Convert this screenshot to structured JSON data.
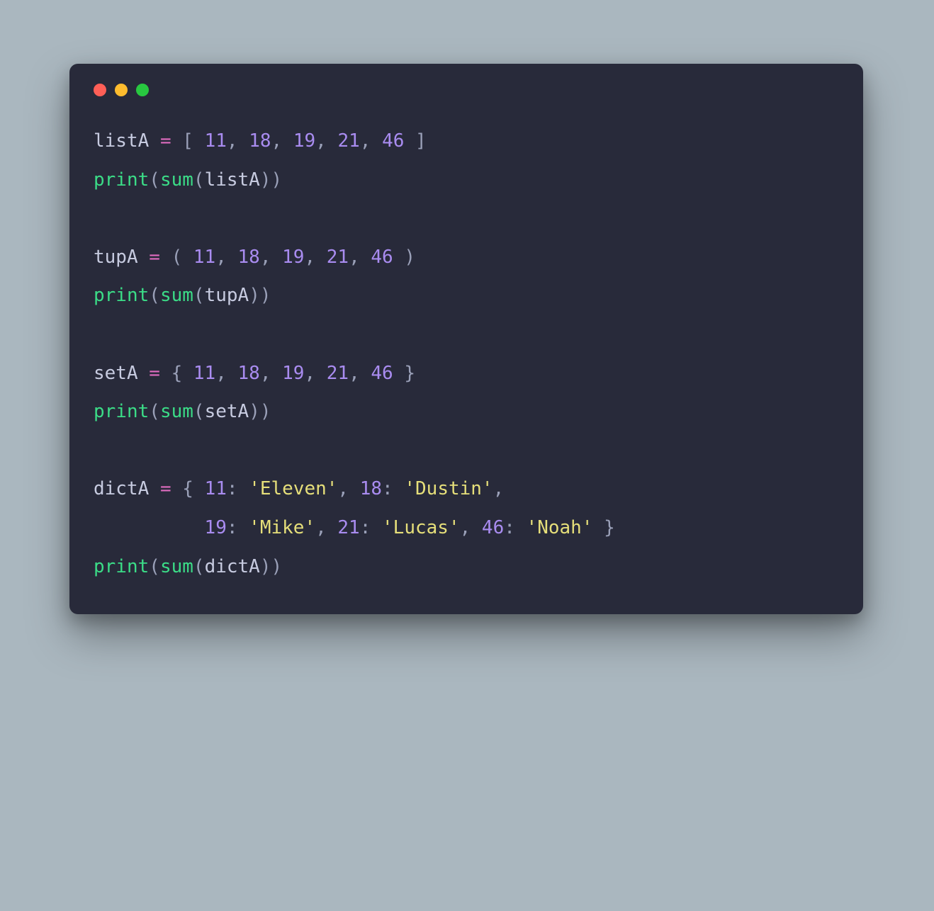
{
  "window": {
    "traffic": [
      "close",
      "minimize",
      "zoom"
    ]
  },
  "code": {
    "lines": [
      [
        {
          "t": "listA",
          "c": "ident"
        },
        {
          "t": " ",
          "c": "ident"
        },
        {
          "t": "=",
          "c": "op"
        },
        {
          "t": " [ ",
          "c": "punc"
        },
        {
          "t": "11",
          "c": "num"
        },
        {
          "t": ", ",
          "c": "punc"
        },
        {
          "t": "18",
          "c": "num"
        },
        {
          "t": ", ",
          "c": "punc"
        },
        {
          "t": "19",
          "c": "num"
        },
        {
          "t": ", ",
          "c": "punc"
        },
        {
          "t": "21",
          "c": "num"
        },
        {
          "t": ", ",
          "c": "punc"
        },
        {
          "t": "46",
          "c": "num"
        },
        {
          "t": " ]",
          "c": "punc"
        }
      ],
      [
        {
          "t": "print",
          "c": "func"
        },
        {
          "t": "(",
          "c": "punc"
        },
        {
          "t": "sum",
          "c": "builtin"
        },
        {
          "t": "(",
          "c": "punc"
        },
        {
          "t": "listA",
          "c": "ident"
        },
        {
          "t": "))",
          "c": "punc"
        }
      ],
      [],
      [
        {
          "t": "tupA",
          "c": "ident"
        },
        {
          "t": " ",
          "c": "ident"
        },
        {
          "t": "=",
          "c": "op"
        },
        {
          "t": " ( ",
          "c": "punc"
        },
        {
          "t": "11",
          "c": "num"
        },
        {
          "t": ", ",
          "c": "punc"
        },
        {
          "t": "18",
          "c": "num"
        },
        {
          "t": ", ",
          "c": "punc"
        },
        {
          "t": "19",
          "c": "num"
        },
        {
          "t": ", ",
          "c": "punc"
        },
        {
          "t": "21",
          "c": "num"
        },
        {
          "t": ", ",
          "c": "punc"
        },
        {
          "t": "46",
          "c": "num"
        },
        {
          "t": " )",
          "c": "punc"
        }
      ],
      [
        {
          "t": "print",
          "c": "func"
        },
        {
          "t": "(",
          "c": "punc"
        },
        {
          "t": "sum",
          "c": "builtin"
        },
        {
          "t": "(",
          "c": "punc"
        },
        {
          "t": "tupA",
          "c": "ident"
        },
        {
          "t": "))",
          "c": "punc"
        }
      ],
      [],
      [
        {
          "t": "setA",
          "c": "ident"
        },
        {
          "t": " ",
          "c": "ident"
        },
        {
          "t": "=",
          "c": "op"
        },
        {
          "t": " { ",
          "c": "punc"
        },
        {
          "t": "11",
          "c": "num"
        },
        {
          "t": ", ",
          "c": "punc"
        },
        {
          "t": "18",
          "c": "num"
        },
        {
          "t": ", ",
          "c": "punc"
        },
        {
          "t": "19",
          "c": "num"
        },
        {
          "t": ", ",
          "c": "punc"
        },
        {
          "t": "21",
          "c": "num"
        },
        {
          "t": ", ",
          "c": "punc"
        },
        {
          "t": "46",
          "c": "num"
        },
        {
          "t": " }",
          "c": "punc"
        }
      ],
      [
        {
          "t": "print",
          "c": "func"
        },
        {
          "t": "(",
          "c": "punc"
        },
        {
          "t": "sum",
          "c": "builtin"
        },
        {
          "t": "(",
          "c": "punc"
        },
        {
          "t": "setA",
          "c": "ident"
        },
        {
          "t": "))",
          "c": "punc"
        }
      ],
      [],
      [
        {
          "t": "dictA",
          "c": "ident"
        },
        {
          "t": " ",
          "c": "ident"
        },
        {
          "t": "=",
          "c": "op"
        },
        {
          "t": " { ",
          "c": "punc"
        },
        {
          "t": "11",
          "c": "num"
        },
        {
          "t": ": ",
          "c": "punc"
        },
        {
          "t": "'Eleven'",
          "c": "str"
        },
        {
          "t": ", ",
          "c": "punc"
        },
        {
          "t": "18",
          "c": "num"
        },
        {
          "t": ": ",
          "c": "punc"
        },
        {
          "t": "'Dustin'",
          "c": "str"
        },
        {
          "t": ",",
          "c": "punc"
        }
      ],
      [
        {
          "t": "          ",
          "c": "ident"
        },
        {
          "t": "19",
          "c": "num"
        },
        {
          "t": ": ",
          "c": "punc"
        },
        {
          "t": "'Mike'",
          "c": "str"
        },
        {
          "t": ", ",
          "c": "punc"
        },
        {
          "t": "21",
          "c": "num"
        },
        {
          "t": ": ",
          "c": "punc"
        },
        {
          "t": "'Lucas'",
          "c": "str"
        },
        {
          "t": ", ",
          "c": "punc"
        },
        {
          "t": "46",
          "c": "num"
        },
        {
          "t": ": ",
          "c": "punc"
        },
        {
          "t": "'Noah'",
          "c": "str"
        },
        {
          "t": " }",
          "c": "punc"
        }
      ],
      [
        {
          "t": "print",
          "c": "func"
        },
        {
          "t": "(",
          "c": "punc"
        },
        {
          "t": "sum",
          "c": "builtin"
        },
        {
          "t": "(",
          "c": "punc"
        },
        {
          "t": "dictA",
          "c": "ident"
        },
        {
          "t": "))",
          "c": "punc"
        }
      ]
    ]
  }
}
